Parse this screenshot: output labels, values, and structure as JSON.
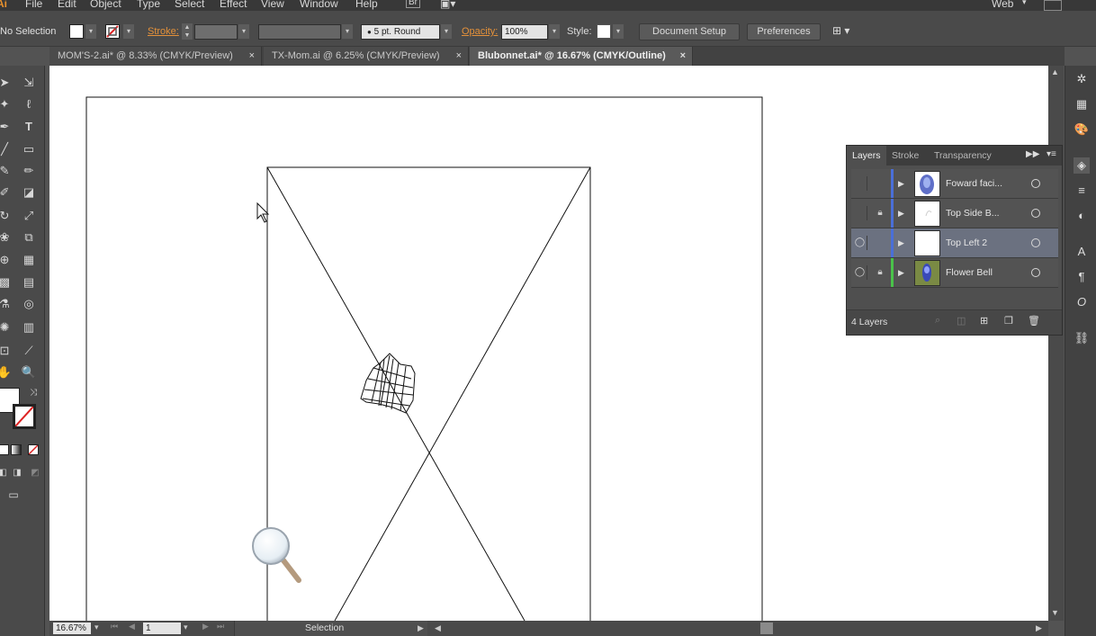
{
  "menu": [
    "File",
    "Edit",
    "Object",
    "Type",
    "Select",
    "Effect",
    "View",
    "Window",
    "Help"
  ],
  "workspace": "Web",
  "control_bar": {
    "selection": "No Selection",
    "stroke_label": "Stroke:",
    "brush": "5 pt. Round",
    "opacity_label": "Opacity:",
    "opacity_value": "100%",
    "style_label": "Style:",
    "document_setup": "Document Setup",
    "preferences": "Preferences"
  },
  "tabs": [
    {
      "label": "MOM'S-2.ai* @ 8.33% (CMYK/Preview)",
      "close": "×"
    },
    {
      "label": "TX-Mom.ai @ 6.25% (CMYK/Preview)",
      "close": "×"
    },
    {
      "label": "Blubonnet.ai* @ 16.67% (CMYK/Outline)",
      "close": "×"
    }
  ],
  "status_bar": {
    "zoom": "16.67%",
    "artboard": "1",
    "tool": "Selection"
  },
  "layers_panel": {
    "tabs": [
      "Layers",
      "Stroke",
      "Transparency"
    ],
    "layers": [
      {
        "name": "Foward faci...",
        "visible": false,
        "locked": false,
        "color": "#4a6fd8",
        "selected": false
      },
      {
        "name": "Top Side B...",
        "visible": false,
        "locked": true,
        "color": "#4a6fd8",
        "selected": false
      },
      {
        "name": "Top Left 2",
        "visible": true,
        "locked": false,
        "color": "#4a6fd8",
        "selected": true
      },
      {
        "name": "Flower Bell",
        "visible": true,
        "locked": true,
        "color": "#4ac24a",
        "selected": false
      }
    ],
    "count": "4 Layers"
  },
  "icons": {
    "visible": "◯",
    "lock": "🔒",
    "expand": "▶",
    "target": "○"
  }
}
